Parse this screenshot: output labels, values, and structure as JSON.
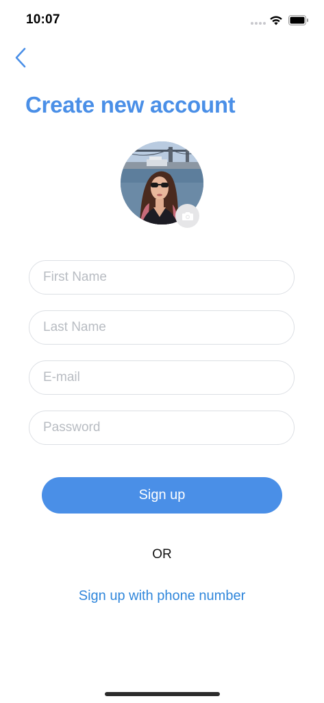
{
  "status_bar": {
    "time": "10:07",
    "icons": [
      "cellular-dots-icon",
      "wifi-icon",
      "battery-icon"
    ]
  },
  "nav": {
    "back_icon": "chevron-left-icon"
  },
  "title": "Create new account",
  "avatar": {
    "camera_icon": "camera-icon"
  },
  "form": {
    "first_name_placeholder": "First Name",
    "last_name_placeholder": "Last Name",
    "email_placeholder": "E-mail",
    "password_placeholder": "Password"
  },
  "actions": {
    "signup_label": "Sign up",
    "or_label": "OR",
    "phone_signup_label": "Sign up with phone number"
  },
  "colors": {
    "accent": "#4a8fe7",
    "link": "#2f86db",
    "field_border": "#dcdfe4",
    "placeholder": "#b8bcc2"
  }
}
